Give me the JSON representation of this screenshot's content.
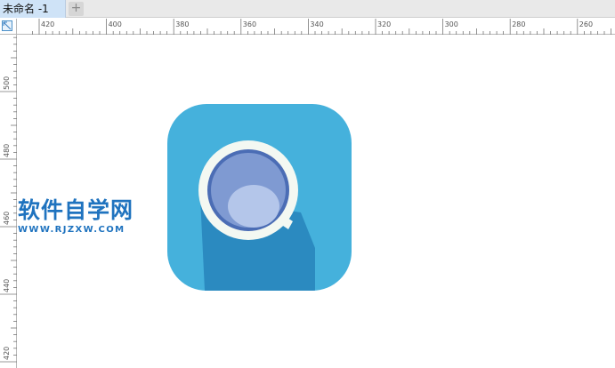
{
  "tabs": {
    "active_label": "未命名 -1",
    "add_label": "+"
  },
  "rulers": {
    "horizontal_labels": [
      "420",
      "400",
      "380",
      "360",
      "340",
      "320",
      "300",
      "280",
      "260"
    ],
    "vertical_labels": [
      "500",
      "480",
      "460",
      "440",
      "420"
    ]
  },
  "watermark": {
    "title": "软件自学网",
    "url": "WWW.RJZXW.COM"
  },
  "colors": {
    "icon_background": "#45b1dc",
    "icon_shadow": "#2b8ac0",
    "lens_ring": "#f3f8f2",
    "lens_dark": "#4b6db5",
    "lens_mid": "#7f9ad2",
    "lens_light": "#b4c6ea",
    "brand_blue": "#1f73bf"
  },
  "icons": {
    "corner": "ruler-origin-icon",
    "app_icon": "magnifier-app-icon"
  }
}
